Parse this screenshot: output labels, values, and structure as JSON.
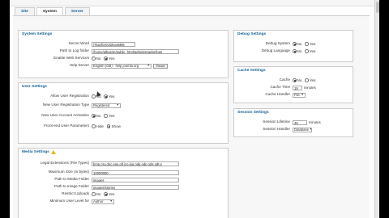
{
  "tabs": [
    "Site",
    "System",
    "Server"
  ],
  "system_settings": {
    "title": "System Settings",
    "rows": [
      {
        "label": "Secret Word",
        "value": "iTkpzfQXQDkoyBM5"
      },
      {
        "label": "Path to Log folder",
        "value": "/home/albasire/public_html/administrador/logs"
      },
      {
        "label": "Enable Web Services",
        "options": [
          "No",
          "Yes"
        ],
        "selected": "Yes"
      },
      {
        "label": "Help Server",
        "value": "English (GB) - help.joomla.org",
        "button": "Reset"
      }
    ]
  },
  "user_settings": {
    "title": "User Settings",
    "allow_registration": {
      "label": "Allow User Registration",
      "options": [
        "No",
        "Yes"
      ],
      "selected": "Yes"
    },
    "new_user_type": {
      "label": "New User Registration Type",
      "value": "Registered"
    },
    "new_user_activation": {
      "label": "New User Account Activation",
      "options": [
        "No",
        "Yes"
      ],
      "selected": "No"
    },
    "frontend_parameters": {
      "label": "Front-end User Parameters",
      "options": [
        "Hide",
        "Show"
      ],
      "selected": "Show"
    }
  },
  "media_settings": {
    "title": "Media Settings",
    "rows": [
      {
        "label": "Legal Extensions (File Types)",
        "value": "bmp,csv,doc,epg,gif,ico,jpg,odg,odp,ods,odt,p"
      },
      {
        "label": "Maximum Size (in bytes)",
        "value": "10000000"
      },
      {
        "label": "Path to Media Folder",
        "value": "images"
      },
      {
        "label": "Path to Image Folder",
        "value": "images/stories"
      }
    ],
    "restrict_uploads": {
      "label": "Restrict Uploads",
      "options": [
        "No",
        "Yes"
      ],
      "selected": "Yes"
    },
    "partial_label": "Minimum User Level for",
    "partial_value": "Author"
  },
  "debug_settings": {
    "title": "Debug Settings",
    "debug_system": {
      "label": "Debug System",
      "options": [
        "No",
        "Yes"
      ],
      "selected": "No"
    },
    "debug_language": {
      "label": "Debug Language",
      "options": [
        "No",
        "Yes"
      ],
      "selected": "No"
    }
  },
  "cache_settings": {
    "title": "Cache Settings",
    "cache": {
      "label": "Cache",
      "options": [
        "No",
        "Yes"
      ],
      "selected": "No"
    },
    "cache_time": {
      "label": "Cache Time",
      "value": "15",
      "unit": "minutes"
    },
    "cache_handler": {
      "label": "Cache Handler",
      "value": "File"
    }
  },
  "session_settings": {
    "title": "Session Settings",
    "session_lifetime": {
      "label": "Session Lifetime",
      "value": "45",
      "unit": "minutes"
    },
    "session_handler": {
      "label": "Session Handler",
      "value": "Database"
    }
  }
}
